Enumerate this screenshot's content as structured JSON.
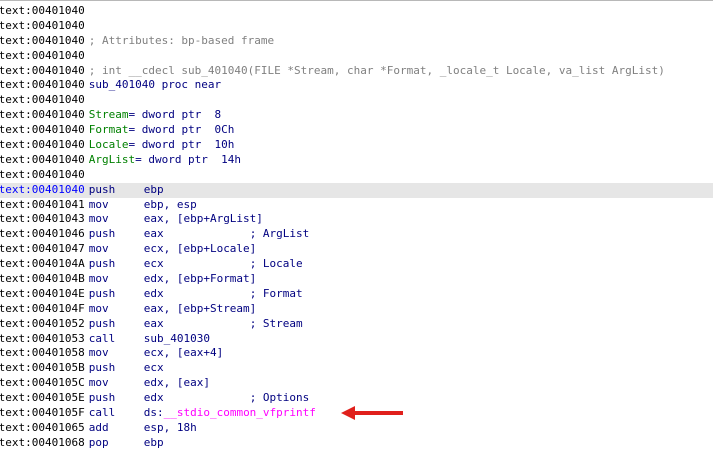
{
  "lines": [
    {
      "addr": ".text:00401040",
      "type": "blank"
    },
    {
      "addr": ".text:00401040",
      "type": "blank"
    },
    {
      "addr": ".text:00401040",
      "type": "comment",
      "text": "; Attributes: bp-based frame"
    },
    {
      "addr": ".text:00401040",
      "type": "blank"
    },
    {
      "addr": ".text:00401040",
      "type": "comment",
      "text": "; int __cdecl sub_401040(FILE *Stream, char *Format, _locale_t Locale, va_list ArgList)"
    },
    {
      "addr": ".text:00401040",
      "type": "proc",
      "text": "sub_401040 proc near"
    },
    {
      "addr": ".text:00401040",
      "type": "blank"
    },
    {
      "addr": ".text:00401040",
      "type": "var",
      "name": "Stream",
      "def": "= dword ptr  8"
    },
    {
      "addr": ".text:00401040",
      "type": "var",
      "name": "Format",
      "def": "= dword ptr  0Ch"
    },
    {
      "addr": ".text:00401040",
      "type": "var",
      "name": "Locale",
      "def": "= dword ptr  10h"
    },
    {
      "addr": ".text:00401040",
      "type": "var",
      "name": "ArgList",
      "def": "= dword ptr  14h"
    },
    {
      "addr": ".text:00401040",
      "type": "blank"
    },
    {
      "addr": ".text:00401040",
      "type": "ins",
      "mn": "push",
      "op": "ebp",
      "highlight": true
    },
    {
      "addr": ".text:00401041",
      "type": "ins",
      "mn": "mov",
      "op": "ebp, esp"
    },
    {
      "addr": ".text:00401043",
      "type": "ins",
      "mn": "mov",
      "op": "eax, [ebp+ArgList]"
    },
    {
      "addr": ".text:00401046",
      "type": "ins",
      "mn": "push",
      "op": "eax             ",
      "cmt": "; ArgList"
    },
    {
      "addr": ".text:00401047",
      "type": "ins",
      "mn": "mov",
      "op": "ecx, [ebp+Locale]"
    },
    {
      "addr": ".text:0040104A",
      "type": "ins",
      "mn": "push",
      "op": "ecx             ",
      "cmt": "; Locale"
    },
    {
      "addr": ".text:0040104B",
      "type": "ins",
      "mn": "mov",
      "op": "edx, [ebp+Format]"
    },
    {
      "addr": ".text:0040104E",
      "type": "ins",
      "mn": "push",
      "op": "edx             ",
      "cmt": "; Format"
    },
    {
      "addr": ".text:0040104F",
      "type": "ins",
      "mn": "mov",
      "op": "eax, [ebp+Stream]"
    },
    {
      "addr": ".text:00401052",
      "type": "ins",
      "mn": "push",
      "op": "eax             ",
      "cmt": "; Stream"
    },
    {
      "addr": ".text:00401053",
      "type": "ins",
      "mn": "call",
      "op": "sub_401030"
    },
    {
      "addr": ".text:00401058",
      "type": "ins",
      "mn": "mov",
      "op": "ecx, [eax+4]"
    },
    {
      "addr": ".text:0040105B",
      "type": "ins",
      "mn": "push",
      "op": "ecx"
    },
    {
      "addr": ".text:0040105C",
      "type": "ins",
      "mn": "mov",
      "op": "edx, [eax]"
    },
    {
      "addr": ".text:0040105E",
      "type": "ins",
      "mn": "push",
      "op": "edx             ",
      "cmt": "; Options"
    },
    {
      "addr": ".text:0040105F",
      "type": "ins",
      "mn": "call",
      "op": "ds:",
      "ext": "__stdio_common_vfprintf"
    },
    {
      "addr": ".text:00401065",
      "type": "ins",
      "mn": "add",
      "op": "esp, 18h"
    },
    {
      "addr": ".text:00401068",
      "type": "ins",
      "mn": "pop",
      "op": "ebp"
    }
  ],
  "annotation": {
    "icon": "red-arrow-icon",
    "color": "#e0201c"
  }
}
